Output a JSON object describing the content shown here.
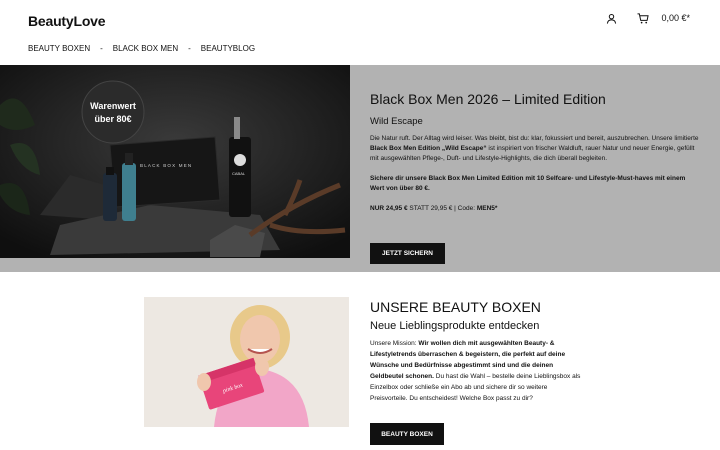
{
  "header": {
    "logo": "BeautyLove",
    "cart_total": "0,00 €*",
    "icons": [
      "user-icon",
      "cart-icon"
    ]
  },
  "nav": {
    "items": [
      "BEAUTY BOXEN",
      "BLACK BOX MEN",
      "BEAUTYBLOG"
    ],
    "separator": "-"
  },
  "hero": {
    "badge_line1": "Warenwert",
    "badge_line2": "über 80€",
    "box_label": "BLACK BOX MEN",
    "product_label": "CABAL",
    "title": "Black Box Men 2026 – Limited Edition",
    "subtitle": "Wild Escape",
    "body_1": "Die Natur ruft. Der Alltag wird leiser. Was bleibt, bist du: klar, fokussiert und bereit, auszubrechen. Unsere limitierte ",
    "body_bold": "Black Box Men Edition „Wild Escape“",
    "body_2": " ist inspiriert von frischer Waldluft, rauer Natur und neuer Energie, gefüllt mit ausgewählten Pflege-, Duft- und Lifestyle-Highlights, die dich überall begleiten.",
    "cta_line": "Sichere dir unsere Black Box Men Limited Edition mit 10 Selfcare- und Lifestyle-Must-haves mit einem Wert von über 80 €.",
    "price_now": "NUR 24,95 €",
    "price_was": " STATT 29,95 € | Code: ",
    "code": "MEN5*",
    "button": "JETZT SICHERN"
  },
  "boxes": {
    "box_label": "pink box",
    "title": "UNSERE BEAUTY BOXEN",
    "subtitle": "Neue Lieblingsprodukte entdecken",
    "body_1": "Unsere Mission: ",
    "body_bold": "Wir wollen dich mit ausgewählten Beauty- & Lifestyletrends überraschen & begeistern, die perfekt auf deine Wünsche und Bedürfnisse abgestimmt sind und die deinen Geldbeutel schonen.",
    "body_2": " Du hast die Wahl – bestelle deine Lieblingsbox als Einzelbox oder schließe ein Abo ab und sichere dir so weitere Preisvorteile. Du entscheidest! Welche Box passt zu dir?",
    "button": "BEAUTY BOXEN"
  }
}
